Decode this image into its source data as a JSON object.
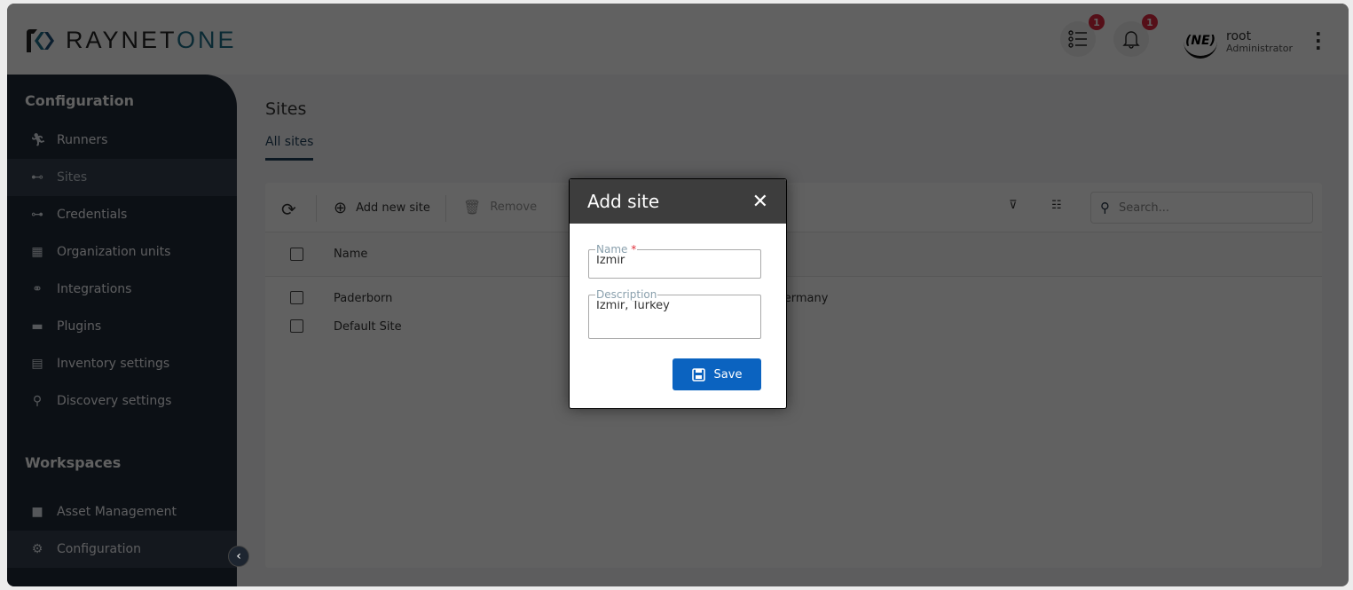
{
  "app": {
    "brand_left": "RAYNET",
    "brand_right": "ONE"
  },
  "header": {
    "tasks_badge": "1",
    "notifications_badge": "1",
    "user": {
      "avatar_text": "(NE)",
      "name": "root",
      "role": "Administrator"
    }
  },
  "sidebar": {
    "config_title": "Configuration",
    "items": [
      {
        "label": "Runners",
        "icon": "runner-icon"
      },
      {
        "label": "Sites",
        "icon": "sites-icon"
      },
      {
        "label": "Credentials",
        "icon": "key-icon"
      },
      {
        "label": "Organization units",
        "icon": "building-icon"
      },
      {
        "label": "Integrations",
        "icon": "webhook-icon"
      },
      {
        "label": "Plugins",
        "icon": "plugin-icon"
      },
      {
        "label": "Inventory settings",
        "icon": "inventory-icon"
      },
      {
        "label": "Discovery settings",
        "icon": "search-icon"
      }
    ],
    "workspaces_title": "Workspaces",
    "workspaces": [
      {
        "label": "Asset Management",
        "icon": "briefcase-icon"
      },
      {
        "label": "Configuration",
        "icon": "gear-icon"
      }
    ],
    "active": "Sites"
  },
  "main": {
    "title": "Sites",
    "tab": "All sites",
    "toolbar": {
      "add": "Add new site",
      "remove": "Remove",
      "search_placeholder": "Search..."
    },
    "columns": [
      "Name"
    ],
    "rows": [
      {
        "name": "Paderborn",
        "description": "Paderborn, Germany"
      },
      {
        "name": "Default Site",
        "description": ""
      }
    ]
  },
  "modal": {
    "title": "Add site",
    "name_label": "Name",
    "required_mark": "*",
    "name_value": "Izmir",
    "description_label": "Description",
    "description_value": "Izmir, Turkey",
    "save": "Save"
  },
  "colors": {
    "accent": "#0b63c0",
    "badge": "#c5162c",
    "sidebar": "#161f2a"
  }
}
